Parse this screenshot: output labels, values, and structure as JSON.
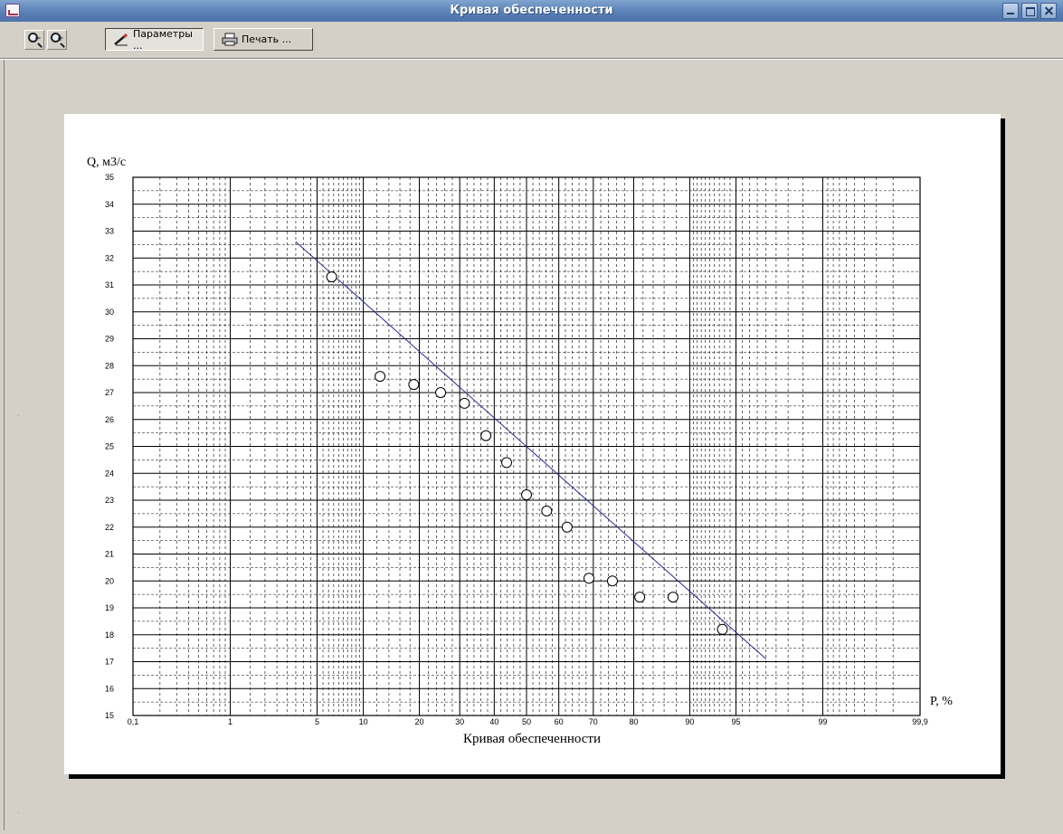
{
  "window": {
    "title": "Кривая обеспеченности"
  },
  "toolbar": {
    "zoom_out_icon": "zoom-out-icon",
    "zoom_in_icon": "zoom-in-icon",
    "params_label": "Параметры ...",
    "print_label": "Печать ..."
  },
  "colors": {
    "fit_line": "#2a2a9a",
    "grid": "#000000",
    "markers": "#000000",
    "titlebar": "#5a80b6"
  },
  "chart_data": {
    "type": "scatter",
    "title": "Кривая обеспеченности",
    "xlabel": "P, %",
    "ylabel": "Q, м3/с",
    "x_scale": "probability",
    "ylim": [
      15,
      35
    ],
    "grid": true,
    "x_ticks": [
      {
        "value": 0.1,
        "label": "0,1"
      },
      {
        "value": 1,
        "label": "1"
      },
      {
        "value": 5,
        "label": "5"
      },
      {
        "value": 10,
        "label": "10"
      },
      {
        "value": 20,
        "label": "20"
      },
      {
        "value": 30,
        "label": "30"
      },
      {
        "value": 40,
        "label": "40"
      },
      {
        "value": 50,
        "label": "50"
      },
      {
        "value": 60,
        "label": "60"
      },
      {
        "value": 70,
        "label": "70"
      },
      {
        "value": 80,
        "label": "80"
      },
      {
        "value": 90,
        "label": "90"
      },
      {
        "value": 95,
        "label": "95"
      },
      {
        "value": 99,
        "label": "99"
      },
      {
        "value": 99.9,
        "label": "99,9"
      }
    ],
    "y_ticks": [
      15,
      16,
      17,
      18,
      19,
      20,
      21,
      22,
      23,
      24,
      25,
      26,
      27,
      28,
      29,
      30,
      31,
      32,
      33,
      34,
      35
    ],
    "points": [
      {
        "x": 6.3,
        "y": 31.3
      },
      {
        "x": 12.5,
        "y": 27.6
      },
      {
        "x": 18.8,
        "y": 27.3
      },
      {
        "x": 25.0,
        "y": 27.0
      },
      {
        "x": 31.3,
        "y": 26.6
      },
      {
        "x": 37.5,
        "y": 25.4
      },
      {
        "x": 43.8,
        "y": 24.4
      },
      {
        "x": 50.0,
        "y": 23.2
      },
      {
        "x": 56.3,
        "y": 22.6
      },
      {
        "x": 62.5,
        "y": 22.0
      },
      {
        "x": 68.8,
        "y": 20.1
      },
      {
        "x": 75.0,
        "y": 20.0
      },
      {
        "x": 81.3,
        "y": 19.4
      },
      {
        "x": 87.5,
        "y": 19.4
      },
      {
        "x": 93.8,
        "y": 18.2
      }
    ],
    "fit_line": [
      {
        "x": 3.5,
        "y": 32.6
      },
      {
        "x": 97.0,
        "y": 17.1
      }
    ]
  }
}
